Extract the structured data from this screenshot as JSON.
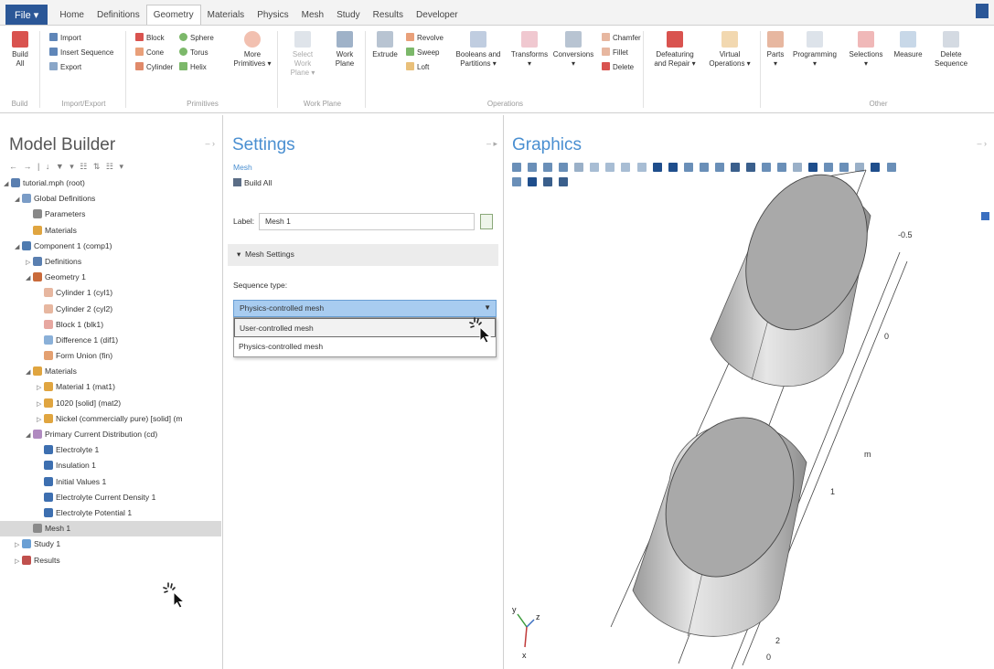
{
  "menu": {
    "file": "File ▾",
    "tabs": [
      "Home",
      "Definitions",
      "Geometry",
      "Materials",
      "Physics",
      "Mesh",
      "Study",
      "Results",
      "Developer"
    ],
    "active": "Geometry"
  },
  "ribbon": {
    "build_all": "Build\nAll",
    "group_build": "Build",
    "import": "Import",
    "insert_sequence": "Insert Sequence",
    "export": "Export",
    "group_import_export": "Import/Export",
    "block": "Block",
    "cone": "Cone",
    "cylinder": "Cylinder",
    "sphere": "Sphere",
    "torus": "Torus",
    "helix": "Helix",
    "more_primitives": "More\nPrimitives ▾",
    "group_primitives": "Primitives",
    "select_work_plane": "Select Work\nPlane ▾",
    "work_plane": "Work\nPlane",
    "group_work_plane": "Work Plane",
    "extrude": "Extrude",
    "revolve": "Revolve",
    "sweep": "Sweep",
    "loft": "Loft",
    "booleans": "Booleans and\nPartitions ▾",
    "transforms": "Transforms\n▾",
    "conversions": "Conversions\n▾",
    "chamfer": "Chamfer",
    "fillet": "Fillet",
    "delete": "Delete",
    "group_operations": "Operations",
    "defeaturing": "Defeaturing\nand Repair ▾",
    "virtual_ops": "Virtual\nOperations ▾",
    "parts": "Parts\n▾",
    "programming": "Programming\n▾",
    "selections": "Selections\n▾",
    "measure": "Measure",
    "delete_sequence": "Delete\nSequence",
    "group_other": "Other"
  },
  "model_builder": {
    "title": "Model Builder",
    "tree": [
      {
        "label": "tutorial.mph (root)",
        "level": 0,
        "toggle": "◢",
        "icon": "#5a7fb0"
      },
      {
        "label": "Global Definitions",
        "level": 1,
        "toggle": "◢",
        "icon": "#7a9cc6"
      },
      {
        "label": "Parameters",
        "level": 2,
        "toggle": "",
        "icon": "#888888"
      },
      {
        "label": "Materials",
        "level": 2,
        "toggle": "",
        "icon": "#e0a540"
      },
      {
        "label": "Component 1 (comp1)",
        "level": 1,
        "toggle": "◢",
        "icon": "#4f7bb0"
      },
      {
        "label": "Definitions",
        "level": 2,
        "toggle": "▷",
        "icon": "#5a7fb0"
      },
      {
        "label": "Geometry 1",
        "level": 2,
        "toggle": "◢",
        "icon": "#c96a3a"
      },
      {
        "label": "Cylinder 1 (cyl1)",
        "level": 3,
        "toggle": "",
        "icon": "#e7b7a0"
      },
      {
        "label": "Cylinder 2 (cyl2)",
        "level": 3,
        "toggle": "",
        "icon": "#e7b7a0"
      },
      {
        "label": "Block 1 (blk1)",
        "level": 3,
        "toggle": "",
        "icon": "#e7a7a0"
      },
      {
        "label": "Difference 1 (dif1)",
        "level": 3,
        "toggle": "",
        "icon": "#8ab0d8"
      },
      {
        "label": "Form Union (fin)",
        "level": 3,
        "toggle": "",
        "icon": "#e4a070"
      },
      {
        "label": "Materials",
        "level": 2,
        "toggle": "◢",
        "icon": "#e0a540"
      },
      {
        "label": "Material 1 (mat1)",
        "level": 3,
        "toggle": "▷",
        "icon": "#e0a540"
      },
      {
        "label": "1020 [solid] (mat2)",
        "level": 3,
        "toggle": "▷",
        "icon": "#e0a540"
      },
      {
        "label": "Nickel (commercially pure) [solid] (m",
        "level": 3,
        "toggle": "▷",
        "icon": "#e0a540"
      },
      {
        "label": "Primary Current Distribution (cd)",
        "level": 2,
        "toggle": "◢",
        "icon": "#b08ac0"
      },
      {
        "label": "Electrolyte 1",
        "level": 3,
        "toggle": "",
        "icon": "#3d6fb0"
      },
      {
        "label": "Insulation 1",
        "level": 3,
        "toggle": "",
        "icon": "#3d6fb0"
      },
      {
        "label": "Initial Values 1",
        "level": 3,
        "toggle": "",
        "icon": "#3d6fb0"
      },
      {
        "label": "Electrolyte Current Density 1",
        "level": 3,
        "toggle": "",
        "icon": "#3d6fb0"
      },
      {
        "label": "Electrolyte Potential 1",
        "level": 3,
        "toggle": "",
        "icon": "#3d6fb0"
      },
      {
        "label": "Mesh 1",
        "level": 2,
        "toggle": "",
        "icon": "#8a8a8a",
        "selected": true
      },
      {
        "label": "Study 1",
        "level": 1,
        "toggle": "▷",
        "icon": "#6a9fd4"
      },
      {
        "label": "Results",
        "level": 1,
        "toggle": "▷",
        "icon": "#c0504d"
      }
    ]
  },
  "settings": {
    "title": "Settings",
    "subtitle": "Mesh",
    "build_all": "Build All",
    "label_prefix": "Label:",
    "label_value": "Mesh 1",
    "section": "Mesh Settings",
    "sequence_type_label": "Sequence type:",
    "sequence_type_value": "Physics-controlled mesh",
    "options": [
      "User-controlled mesh",
      "Physics-controlled mesh"
    ]
  },
  "graphics": {
    "title": "Graphics",
    "axis_ticks": [
      "-0.5",
      "0",
      "1",
      "2",
      "0"
    ],
    "unit": "m",
    "triad": [
      "y",
      "z",
      "x"
    ]
  },
  "colors": {
    "accent": "#4a8fd1",
    "file_tab": "#2b5797",
    "select_highlight": "#a8ccf0"
  }
}
